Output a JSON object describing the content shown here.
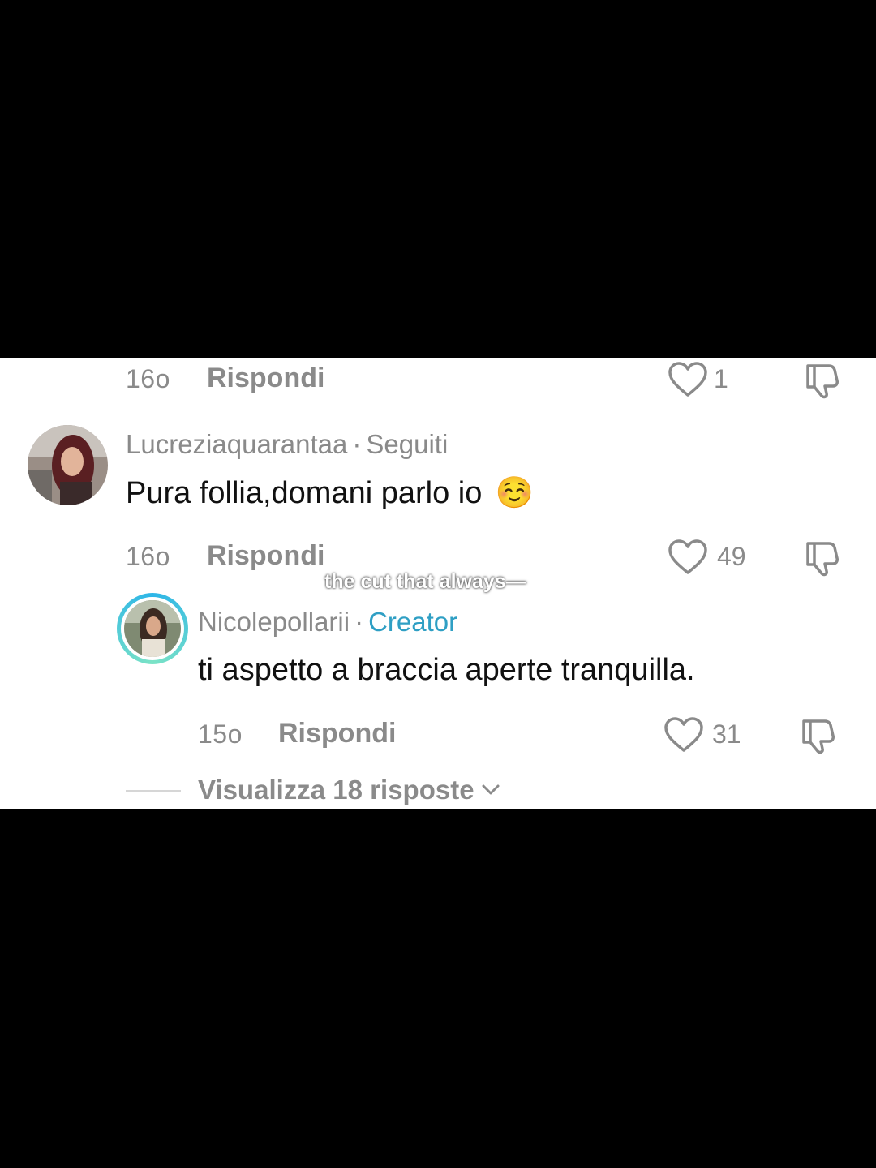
{
  "comments": [
    {
      "time": "16o",
      "reply_label": "Rispondi",
      "likes": "1"
    },
    {
      "username": "Lucreziaquarantaa",
      "separator": "·",
      "tag": "Seguiti",
      "text": "Pura follia,domani parlo io",
      "emoji": "☺️",
      "time": "16o",
      "reply_label": "Rispondi",
      "likes": "49"
    },
    {
      "username": "Nicolepollarii",
      "separator": "·",
      "tag": "Creator",
      "text": "ti aspetto a braccia aperte tranquilla.",
      "time": "15o",
      "reply_label": "Rispondi",
      "likes": "31"
    }
  ],
  "view_replies_label": "Visualizza 18 risposte",
  "caption": "the cut that always—",
  "colors": {
    "creator_tag": "#2f9fc4",
    "meta_gray": "#8a8a8a",
    "background": "#000000"
  },
  "icons": [
    "heart-icon",
    "dislike-icon",
    "chevron-down-icon"
  ]
}
